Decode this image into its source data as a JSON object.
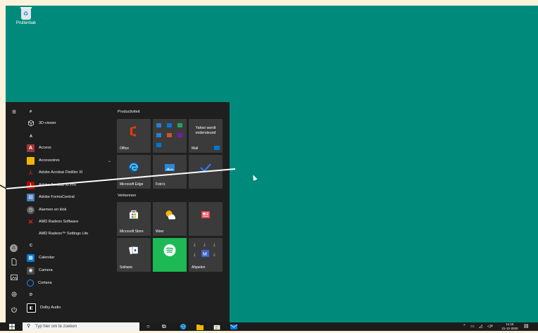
{
  "desktop": {
    "recycle_bin_label": "Prullenbak"
  },
  "rail": {
    "menu": "≡",
    "avatar": "A"
  },
  "applist": {
    "letters": {
      "hash": "#",
      "a": "A",
      "c": "C",
      "d": "D"
    },
    "items": [
      {
        "label": "3D-viewer",
        "icon": "3d-cube-icon"
      },
      {
        "label": "Access",
        "icon": "access-icon"
      },
      {
        "label": "Accessoires",
        "icon": "folder-icon"
      },
      {
        "label": "Adobe Acrobat Distiller XI",
        "icon": "acrobat-icon"
      },
      {
        "label": "Adobe Acrobat XI Pro",
        "icon": "acrobat-icon"
      },
      {
        "label": "Adobe FormsCentral",
        "icon": "forms-icon"
      },
      {
        "label": "Alarmen en klok",
        "icon": "clock-icon"
      },
      {
        "label": "AMD Radeon Software",
        "icon": "amd-icon"
      },
      {
        "label": "AMD Radeon™ Settings Lite",
        "icon": ""
      },
      {
        "label": "Calendar",
        "icon": "calendar-icon"
      },
      {
        "label": "Camera",
        "icon": "camera-icon"
      },
      {
        "label": "Cortana",
        "icon": "cortana-icon"
      },
      {
        "label": "Dolby Audio",
        "icon": "dolby-icon"
      }
    ]
  },
  "tiles": {
    "group_productivity": "Productiviteit",
    "group_explore": "Verkennen",
    "office": "Office",
    "yahoo": "Yahoo wordt ondersteund",
    "mail": "Mail",
    "edge": "Microsoft Edge",
    "photos": "Foto's",
    "store": "Microsoft Store",
    "weather": "Weer",
    "solitaire": "Solitaire",
    "play": "Afspelen"
  },
  "taskbar": {
    "search_placeholder": "Typ hier om te zoeken",
    "time": "11:15",
    "date": "21-12-2020"
  },
  "colors": {
    "desktop": "#008a7c",
    "start_bg": "#1f1f1f",
    "tile_bg": "#3b3b3b",
    "accent": "#0078d4",
    "spotify": "#1db954"
  }
}
